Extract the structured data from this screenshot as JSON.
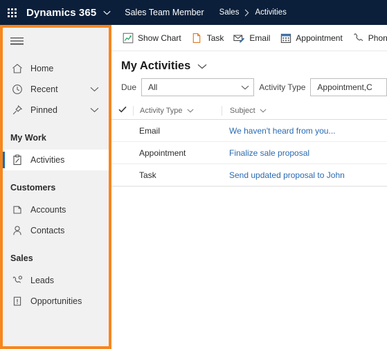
{
  "header": {
    "waffle_icon": "app-launcher-grid-icon",
    "brand": "Dynamics 365",
    "brand_caret_icon": "chevron-down-icon",
    "app_name": "Sales Team Member",
    "breadcrumb": [
      {
        "label": "Sales"
      },
      {
        "label": "Activities"
      }
    ],
    "breadcrumb_separator_icon": "chevron-right-icon",
    "bg_color": "#0b1f3a",
    "text_color": "#ffffff"
  },
  "sidebar": {
    "accent_border_color": "#f7861c",
    "bg_color": "#f1f1f1",
    "selected_accent_color": "#0f6cbd",
    "hamburger_icon": "hamburger-menu-icon",
    "items": [
      {
        "label": "Home",
        "icon": "home-icon",
        "expandable": false,
        "selected": false
      },
      {
        "label": "Recent",
        "icon": "clock-icon",
        "expandable": true,
        "selected": false
      },
      {
        "label": "Pinned",
        "icon": "pin-icon",
        "expandable": true,
        "selected": false
      }
    ],
    "groups": [
      {
        "title": "My Work",
        "items": [
          {
            "label": "Activities",
            "icon": "clipboard-icon",
            "selected": true
          }
        ]
      },
      {
        "title": "Customers",
        "items": [
          {
            "label": "Accounts",
            "icon": "building-icon",
            "selected": false
          },
          {
            "label": "Contacts",
            "icon": "person-icon",
            "selected": false
          }
        ]
      },
      {
        "title": "Sales",
        "items": [
          {
            "label": "Leads",
            "icon": "lead-phone-icon",
            "selected": false
          },
          {
            "label": "Opportunities",
            "icon": "opportunity-icon",
            "selected": false
          }
        ]
      }
    ],
    "expand_icon": "chevron-down-icon"
  },
  "commandbar": {
    "items": [
      {
        "label": "Show Chart",
        "icon": "show-chart-icon"
      },
      {
        "label": "Task",
        "icon": "task-page-icon"
      },
      {
        "label": "Email",
        "icon": "email-envelope-icon"
      },
      {
        "label": "Appointment",
        "icon": "calendar-icon"
      },
      {
        "label": "Phone Call",
        "icon": "phone-icon"
      }
    ]
  },
  "view": {
    "title": "My Activities",
    "title_caret_icon": "chevron-down-icon"
  },
  "filters": [
    {
      "label": "Due",
      "value": "All",
      "caret_icon": "chevron-down-icon",
      "name": "due-filter"
    },
    {
      "label": "Activity Type",
      "value": "Appointment,C",
      "caret_icon": "chevron-down-icon",
      "name": "activity-type-filter"
    }
  ],
  "grid": {
    "select_all_icon": "checkmark-icon",
    "sort_icon": "chevron-down-icon",
    "columns": [
      {
        "label": "Activity Type"
      },
      {
        "label": "Subject"
      }
    ],
    "rows": [
      {
        "activity_type": "Email",
        "subject": "We haven't heard from you..."
      },
      {
        "activity_type": "Appointment",
        "subject": "Finalize sale proposal"
      },
      {
        "activity_type": "Task",
        "subject": "Send updated proposal to John"
      }
    ],
    "link_color": "#2a6bb0"
  }
}
